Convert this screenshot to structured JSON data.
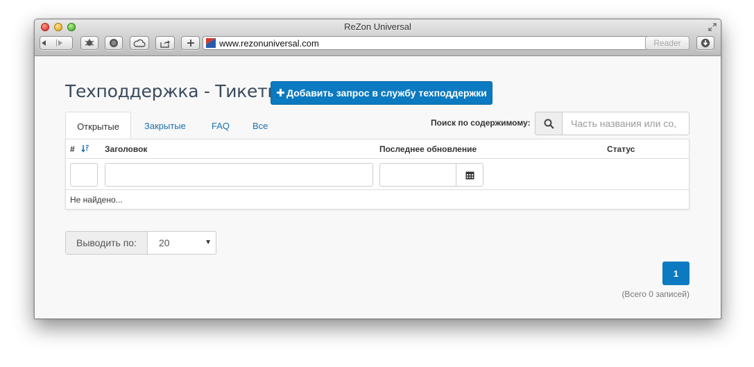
{
  "window": {
    "title": "ReZon Universal",
    "url": "www.rezonuniversal.com",
    "reader_label": "Reader"
  },
  "page": {
    "title": "Техподдержка - Тикеты",
    "add_button_label": "Добавить запрос в службу техподдержки",
    "tabs": [
      {
        "label": "Открытые",
        "active": true
      },
      {
        "label": "Закрытые",
        "active": false
      },
      {
        "label": "FAQ",
        "active": false
      },
      {
        "label": "Все",
        "active": false
      }
    ],
    "search": {
      "label": "Поиск по содержимому:",
      "placeholder": "Часть названия или со,"
    },
    "table": {
      "columns": [
        "#",
        "Заголовок",
        "Последнее обновление",
        "Статус"
      ],
      "empty_text": "Не найдено..."
    },
    "per_page": {
      "label": "Выводить по:",
      "value": "20"
    },
    "pagination": {
      "current_page": "1",
      "total_text": "(Всего 0 записей)"
    }
  },
  "colors": {
    "primary": "#0c7ac0",
    "link": "#1b6fb0",
    "title": "#3a4a5c"
  }
}
